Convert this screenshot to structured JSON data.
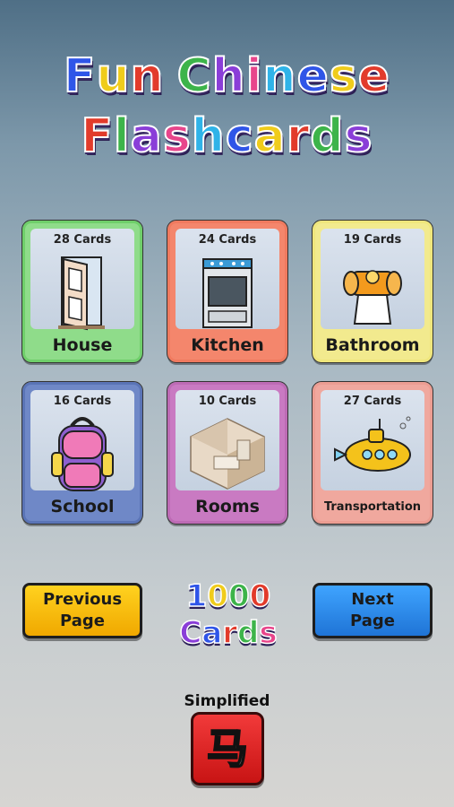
{
  "title": {
    "line1": "Fun Chinese",
    "line2": "Flashcards"
  },
  "colors": {
    "title_letters": [
      "#2f55e8",
      "#f0cc1b",
      "#e23b2b",
      "#3db44a",
      "#8a3ed8",
      "#e8458b",
      "#2fb3e8"
    ]
  },
  "categories": [
    {
      "name": "House",
      "count": "28 Cards",
      "icon": "door-icon",
      "color": "#8fdc8a",
      "border": "#6fcf6a"
    },
    {
      "name": "Kitchen",
      "count": "24 Cards",
      "icon": "stove-icon",
      "color": "#f4866c",
      "border": "#f07a5f"
    },
    {
      "name": "Bathroom",
      "count": "19 Cards",
      "icon": "toilet-paper-icon",
      "color": "#f2ea8e",
      "border": "#efe67c"
    },
    {
      "name": "School",
      "count": "16 Cards",
      "icon": "backpack-icon",
      "color": "#6f88c7",
      "border": "#5a74b6"
    },
    {
      "name": "Rooms",
      "count": "10 Cards",
      "icon": "room-icon",
      "color": "#c97ac2",
      "border": "#bd6bb5"
    },
    {
      "name": "Transportation",
      "count": "27 Cards",
      "icon": "submarine-icon",
      "color": "#f0a89e",
      "border": "#ec9d92"
    }
  ],
  "nav": {
    "previous_line1": "Previous",
    "previous_line2": "Page",
    "next_line1": "Next",
    "next_line2": "Page"
  },
  "total": {
    "line1": "1000",
    "line2": "Cards"
  },
  "script_mode": {
    "label": "Simplified",
    "glyph": "马"
  }
}
